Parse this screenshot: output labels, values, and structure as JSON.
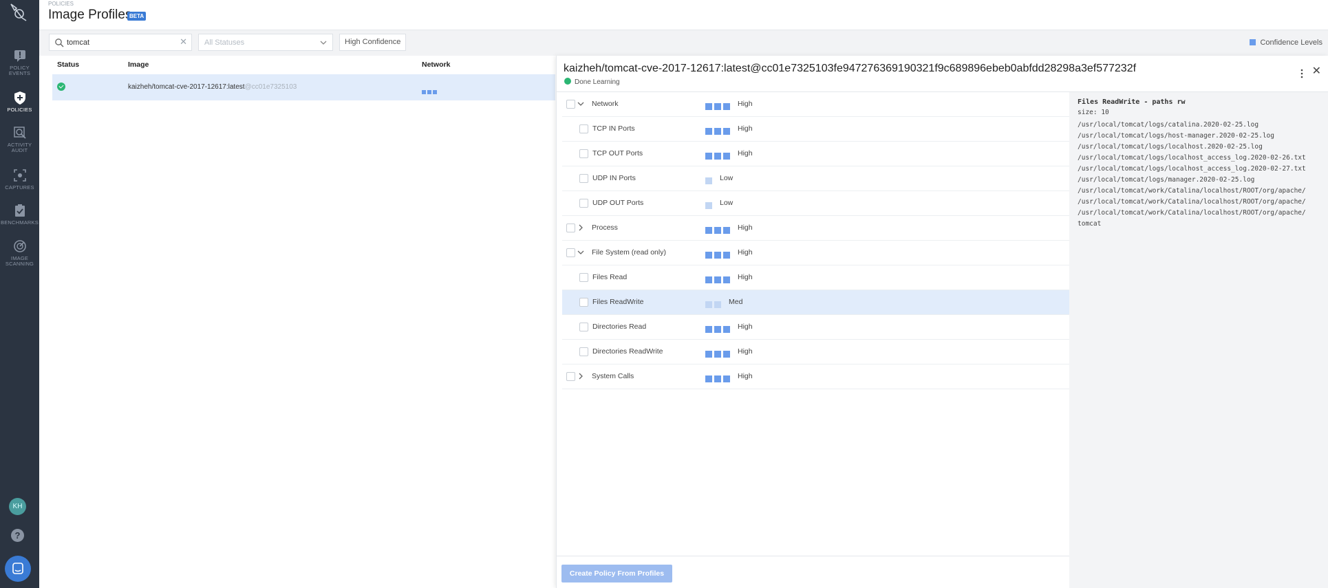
{
  "sidebar": {
    "items": [
      {
        "label": "POLICY EVENTS",
        "icon": "alert-icon"
      },
      {
        "label": "POLICIES",
        "icon": "shield-plus-icon",
        "active": true
      },
      {
        "label": "ACTIVITY AUDIT",
        "icon": "search-icon"
      },
      {
        "label": "CAPTURES",
        "icon": "capture-icon"
      },
      {
        "label": "BENCHMARKS",
        "icon": "clipboard-check-icon"
      },
      {
        "label": "IMAGE SCANNING",
        "icon": "scan-icon"
      }
    ],
    "avatar": "KH",
    "help": "?"
  },
  "header": {
    "breadcrumb": "POLICIES",
    "title": "Image Profiles",
    "badge": "BETA"
  },
  "filters": {
    "search_value": "tomcat",
    "status_placeholder": "All Statuses",
    "confidence_button": "High Confidence",
    "legend": "Confidence Levels"
  },
  "table": {
    "columns": [
      "Status",
      "Image",
      "Network"
    ],
    "rows": [
      {
        "image": "kaizheh/tomcat-cve-2017-12617:latest",
        "digest": "@cc01e7325103",
        "status": "ok",
        "network_level": 3
      }
    ]
  },
  "panel": {
    "title": "kaizheh/tomcat-cve-2017-12617:latest@cc01e7325103fe947276369190321f9c689896ebeb0abfdd28298a3ef577232f",
    "status": "Done Learning",
    "create_button": "Create Policy From Profiles",
    "rows": [
      {
        "label": "Network",
        "level": "High",
        "bars": 3,
        "indent": false,
        "caret": "v"
      },
      {
        "label": "TCP IN Ports",
        "level": "High",
        "bars": 3,
        "indent": true
      },
      {
        "label": "TCP OUT Ports",
        "level": "High",
        "bars": 3,
        "indent": true
      },
      {
        "label": "UDP IN Ports",
        "level": "Low",
        "bars": 1,
        "indent": true
      },
      {
        "label": "UDP OUT Ports",
        "level": "Low",
        "bars": 1,
        "indent": true
      },
      {
        "label": "Process",
        "level": "High",
        "bars": 3,
        "indent": false,
        "caret": ">"
      },
      {
        "label": "File System (read only)",
        "level": "High",
        "bars": 3,
        "indent": false,
        "caret": "v"
      },
      {
        "label": "Files Read",
        "level": "High",
        "bars": 3,
        "indent": true
      },
      {
        "label": "Files ReadWrite",
        "level": "Med",
        "bars": 2,
        "indent": true,
        "selected": true
      },
      {
        "label": "Directories Read",
        "level": "High",
        "bars": 3,
        "indent": true
      },
      {
        "label": "Directories ReadWrite",
        "level": "High",
        "bars": 3,
        "indent": true
      },
      {
        "label": "System Calls",
        "level": "High",
        "bars": 3,
        "indent": false,
        "caret": ">"
      }
    ],
    "files": {
      "title": "Files ReadWrite - paths rw",
      "size": "size: 10",
      "paths": [
        "/usr/local/tomcat/logs/catalina.2020-02-25.log",
        "/usr/local/tomcat/logs/host-manager.2020-02-25.log",
        "/usr/local/tomcat/logs/localhost.2020-02-25.log",
        "/usr/local/tomcat/logs/localhost_access_log.2020-02-26.txt",
        "/usr/local/tomcat/logs/localhost_access_log.2020-02-27.txt",
        "/usr/local/tomcat/logs/manager.2020-02-25.log",
        "/usr/local/tomcat/work/Catalina/localhost/ROOT/org/apache/",
        "/usr/local/tomcat/work/Catalina/localhost/ROOT/org/apache/",
        "/usr/local/tomcat/work/Catalina/localhost/ROOT/org/apache/",
        "tomcat"
      ]
    }
  },
  "colors": {
    "sidebar_bg": "#2b3441",
    "accent": "#3a7bd5",
    "bar_on": "#6a9ceb",
    "bar_off": "#c2d6f3",
    "selected_row": "#e1ecfb",
    "success": "#2bb673"
  }
}
